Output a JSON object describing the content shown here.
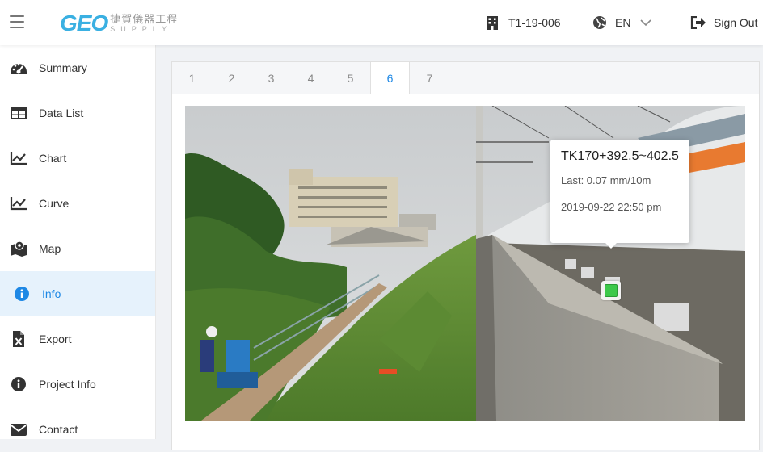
{
  "header": {
    "logo_mark": "GEO",
    "logo_cn": "捷賀儀器工程",
    "logo_en": "SUPPLY",
    "project_code": "T1-19-006",
    "language": "EN",
    "sign_out": "Sign Out"
  },
  "sidebar": {
    "items": [
      {
        "label": "Summary",
        "icon": "gauge-icon"
      },
      {
        "label": "Data List",
        "icon": "table-icon"
      },
      {
        "label": "Chart",
        "icon": "line-chart-icon"
      },
      {
        "label": "Curve",
        "icon": "line-chart-icon"
      },
      {
        "label": "Map",
        "icon": "map-icon"
      },
      {
        "label": "Info",
        "icon": "info-icon",
        "active": true
      },
      {
        "label": "Export",
        "icon": "excel-file-icon"
      },
      {
        "label": "Project Info",
        "icon": "info-icon"
      },
      {
        "label": "Contact",
        "icon": "envelope-icon"
      }
    ]
  },
  "tabs": [
    "1",
    "2",
    "3",
    "4",
    "5",
    "6",
    "7"
  ],
  "active_tab": "6",
  "popup": {
    "title": "TK170+392.5~402.5",
    "last": "Last: 0.07 mm/10m",
    "datetime": "2019-09-22 22:50 pm"
  },
  "colors": {
    "accent": "#1e88e5",
    "active_bg": "#e6f2fc",
    "marker_green": "#3cc84a",
    "logo_blue": "#3ab0e2"
  }
}
